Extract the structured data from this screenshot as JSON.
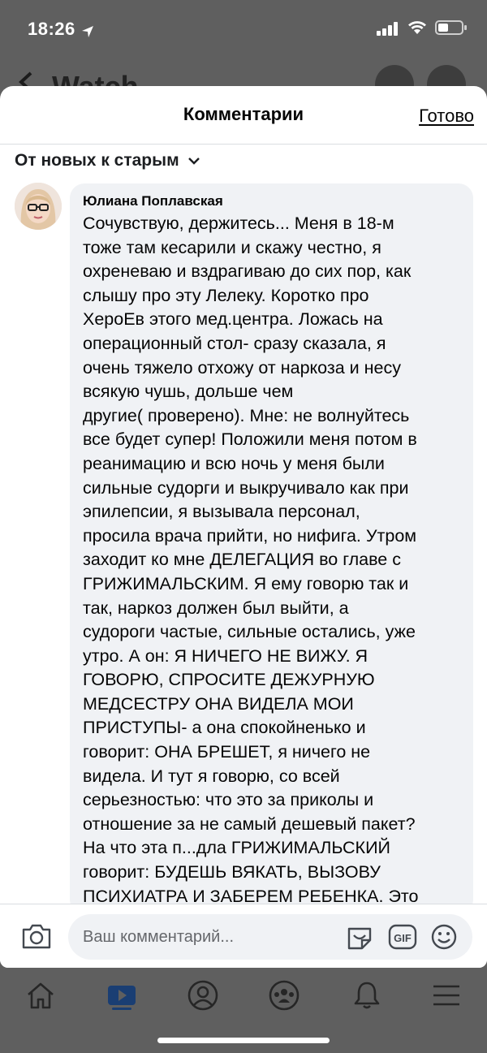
{
  "status": {
    "time": "18:26"
  },
  "backdrop": {
    "title": "Watch"
  },
  "comments_sheet": {
    "title": "Комментарии",
    "done_label": "Готово",
    "sort_label": "От новых к старым"
  },
  "comment": {
    "author": "Юлиана Поплавская",
    "text": "Сочувствую, держитесь... Меня в 18-м\nтоже там кесарили и скажу честно, я\nохреневаю и вздрагиваю до сих пор, как\nслышу про эту Лелеку. Коротко про\nХероЕв этого мед.центра.  Ложась на\nоперационный стол- сразу сказала, я\nочень тяжело отхожу от наркоза и несу\nвсякую чушь, дольше чем\nдругие( проверено). Мне: не волнуйтесь\nвсе будет супер! Положили меня потом в\nреанимацию и всю ночь у меня были\nсильные судорги и выкручивало как при\nэпилепсии, я вызывала персонал,\nпросила врача прийти, но нифига. Утром\nзаходит ко мне ДЕЛЕГАЦИЯ во главе с\nГРИЖИМАЛЬСКИМ. Я ему говорю так и\nтак, наркоз должен был выйти, а\nсудороги частые, сильные остались, уже\nутро. А он: Я НИЧЕГО НЕ ВИЖУ. Я\nГОВОРЮ, СПРОСИТЕ ДЕЖУРНУЮ\nМЕДСЕСТРУ ОНА ВИДЕЛА МОИ\nПРИСТУПЫ- а она спокойненько и\nговорит: ОНА БРЕШЕТ, я ничего не\nвидела. И тут я говорю, со всей\nсерьезностью: что это за приколы и\nотношение за не самый дешевый пакет?\nНа что эта п...дла ГРИЖИМАЛЬСКИЙ\nговорит: БУДЕШЬ ВЯКАТЬ, ВЫЗОВУ\nПСИХИАТРА И ЗАБЕРЕМ РЕБЕНКА. Это\nвсе дословные слова!!!! И что вы"
  },
  "composer": {
    "placeholder": "Ваш комментарий...",
    "gif_label": "GIF"
  },
  "tabbar": {
    "tabs": [
      "home-icon",
      "watch-icon",
      "profile-icon",
      "groups-icon",
      "notifications-icon",
      "menu-icon"
    ],
    "active": "watch-icon"
  },
  "colors": {
    "dim_background": "#5f5f5f",
    "bubble": "#f0f2f5",
    "watch_active": "#1a3e73"
  }
}
